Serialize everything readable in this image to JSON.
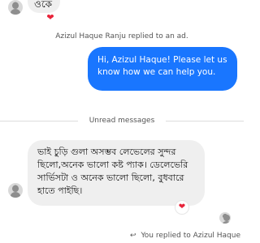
{
  "messages": {
    "top_incoming_text": "ওকে",
    "system_reply_note": "Azizul Haque Ranju replied to an ad.",
    "outgoing_text": "Hi, Azizul Haque! Please let us know how we can help you.",
    "unread_label": "Unread messages",
    "incoming_main_text": "ভাই চুড়ি গুলা অসম্ভব লেভেলের সুন্দর ছিলো,অনেক ভালো কষ্ট প্যাক। ডেলেভেরি সার্ভিসটা ও অনেক ভালো ছিলো, বুধবারে হাতে পাইছি।",
    "footer_reply_note": "You replied to Azizul Haque"
  },
  "reactions": {
    "heart_glyph": "❤"
  },
  "icons": {
    "avatar": "user-avatar",
    "reply": "reply-arrow-icon"
  },
  "colors": {
    "outgoing_bubble": "#1976ff",
    "incoming_bubble": "#efefef",
    "heart": "#e8243a"
  }
}
